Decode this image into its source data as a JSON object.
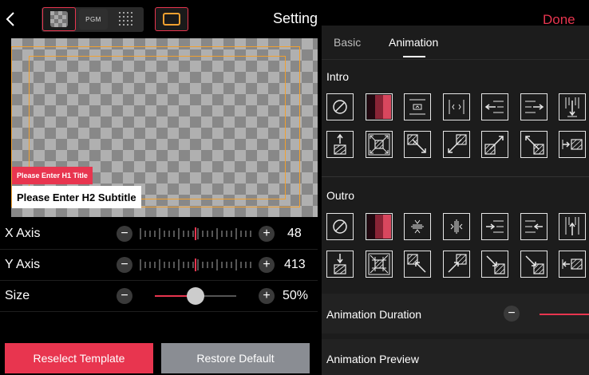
{
  "header": {
    "title": "Setting",
    "done_label": "Done",
    "view_modes": [
      {
        "name": "transparent-preview",
        "icon": "checker-icon",
        "active": true
      },
      {
        "name": "pgm",
        "label": "PGM",
        "active": false
      },
      {
        "name": "grid",
        "icon": "dots-grid-icon",
        "active": false
      }
    ],
    "frame_icon": "safe-frame-icon"
  },
  "preview": {
    "h1_title": "Please Enter H1 Title",
    "h2_subtitle": "Please Enter H2 Subtitle"
  },
  "controls": {
    "x_axis": {
      "label": "X Axis",
      "value": "48"
    },
    "y_axis": {
      "label": "Y Axis",
      "value": "413"
    },
    "size": {
      "label": "Size",
      "value": "50%",
      "fraction": 0.5
    }
  },
  "buttons": {
    "reselect": "Reselect Template",
    "restore": "Restore Default"
  },
  "panel": {
    "tabs": [
      {
        "label": "Basic",
        "active": false
      },
      {
        "label": "Animation",
        "active": true
      }
    ],
    "intro_label": "Intro",
    "outro_label": "Outro",
    "intro_icons": [
      "none-icon",
      "fade-gradient-icon",
      "expand-vertical-icon",
      "expand-horizontal-icon",
      "slide-left-icon",
      "slide-right-icon",
      "slide-down-icon",
      "slide-up-icon",
      "zoom-out-icon",
      "slide-diagonal-topleft-icon",
      "slide-diagonal-bottomleft-icon",
      "slide-diagonal-bottomright-icon",
      "slide-diagonal-topright-icon",
      "wipe-right-icon"
    ],
    "outro_icons": [
      "none-icon",
      "fade-gradient-icon",
      "collapse-vertical-icon",
      "collapse-horizontal-icon",
      "slide-right-out-icon",
      "slide-left-out-icon",
      "slide-up-out-icon",
      "slide-down-out-icon",
      "zoom-in-icon",
      "slide-diagonal-in-topleft-icon",
      "slide-diagonal-in-topright-icon",
      "slide-diagonal-in-bottomleft-icon",
      "slide-diagonal-in-bottomright-icon",
      "wipe-left-icon"
    ],
    "duration_label": "Animation Duration",
    "preview_label": "Animation Preview"
  },
  "colors": {
    "accent": "#e8354f",
    "guide": "#f0a030",
    "panel_bg": "#1c1c1c",
    "restore_bg": "#8a8d93"
  }
}
